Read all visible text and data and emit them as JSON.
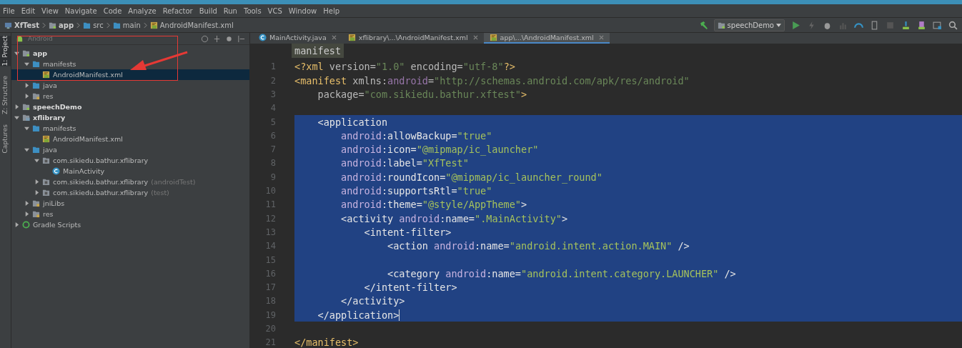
{
  "menu": [
    "File",
    "Edit",
    "View",
    "Navigate",
    "Code",
    "Analyze",
    "Refactor",
    "Build",
    "Run",
    "Tools",
    "VCS",
    "Window",
    "Help"
  ],
  "breadcrumbs": [
    {
      "label": "XfTest",
      "kind": "project"
    },
    {
      "label": "app",
      "kind": "module"
    },
    {
      "label": "src",
      "kind": "folder"
    },
    {
      "label": "main",
      "kind": "folder"
    },
    {
      "label": "AndroidManifest.xml",
      "kind": "manifest"
    }
  ],
  "run_config": "speechDemo",
  "tool_strip": [
    {
      "label": "1: Project",
      "selected": true
    },
    {
      "label": "Z: Structure",
      "selected": false
    },
    {
      "label": "Captures",
      "selected": false
    }
  ],
  "project_panel": {
    "view": "Android",
    "tree": [
      {
        "label": "app",
        "kind": "module",
        "bold": true,
        "expanded": true,
        "children": [
          {
            "label": "manifests",
            "kind": "folder",
            "expanded": true,
            "children": [
              {
                "label": "AndroidManifest.xml",
                "kind": "manifest",
                "selected": true
              }
            ]
          },
          {
            "label": "java",
            "kind": "folder",
            "expanded": false
          },
          {
            "label": "res",
            "kind": "res",
            "expanded": false
          }
        ]
      },
      {
        "label": "speechDemo",
        "kind": "module",
        "bold": true,
        "expanded": false
      },
      {
        "label": "xflibrary",
        "kind": "library",
        "bold": true,
        "expanded": true,
        "children": [
          {
            "label": "manifests",
            "kind": "folder",
            "expanded": true,
            "children": [
              {
                "label": "AndroidManifest.xml",
                "kind": "manifest",
                "selected": false
              }
            ]
          },
          {
            "label": "java",
            "kind": "folder",
            "expanded": true,
            "children": [
              {
                "label": "com.sikiedu.bathur.xflibrary",
                "kind": "package",
                "expanded": true,
                "children": [
                  {
                    "label": "MainActivity",
                    "kind": "class",
                    "selected": false
                  }
                ]
              },
              {
                "label": "com.sikiedu.bathur.xflibrary",
                "note": "(androidTest)",
                "kind": "package",
                "expanded": false
              },
              {
                "label": "com.sikiedu.bathur.xflibrary",
                "note": "(test)",
                "kind": "package",
                "expanded": false
              }
            ]
          },
          {
            "label": "jniLibs",
            "kind": "res",
            "expanded": false
          },
          {
            "label": "res",
            "kind": "res",
            "expanded": false
          }
        ]
      },
      {
        "label": "Gradle Scripts",
        "kind": "gradle",
        "bold": false,
        "expanded": false
      }
    ]
  },
  "editor_tabs": [
    {
      "label": "MainActivity.java",
      "kind": "class",
      "selected": false
    },
    {
      "label": "xflibrary\\...\\AndroidManifest.xml",
      "kind": "manifest",
      "selected": false
    },
    {
      "label": "app\\...\\AndroidManifest.xml",
      "kind": "manifest",
      "selected": true
    }
  ],
  "tag_breadcrumb": "manifest",
  "code_lines": [
    {
      "number": "1",
      "selected": false,
      "tokens": [
        {
          "kind": "tag",
          "text": "<?xml "
        },
        {
          "kind": "attr",
          "text": "version="
        },
        {
          "kind": "value",
          "text": "\"1.0\""
        },
        {
          "kind": "attr",
          "text": " encoding="
        },
        {
          "kind": "value",
          "text": "\"utf-8\""
        },
        {
          "kind": "tag",
          "text": "?>"
        }
      ]
    },
    {
      "number": "2",
      "selected": false,
      "tokens": [
        {
          "kind": "tag",
          "text": "<manifest "
        },
        {
          "kind": "attr",
          "text": "xmlns:"
        },
        {
          "kind": "ns",
          "text": "android"
        },
        {
          "kind": "attr",
          "text": "="
        },
        {
          "kind": "value",
          "text": "\"http://schemas.android.com/apk/res/android\""
        }
      ]
    },
    {
      "number": "3",
      "selected": false,
      "tokens": [
        {
          "kind": "attr",
          "text": "    package="
        },
        {
          "kind": "value",
          "text": "\"com.sikiedu.bathur.xftest\""
        },
        {
          "kind": "tag",
          "text": ">"
        }
      ]
    },
    {
      "number": "4",
      "selected": false
    },
    {
      "number": "5",
      "selected": true,
      "tokens": [
        {
          "kind": "tag",
          "text": "    <application"
        }
      ]
    },
    {
      "number": "6",
      "selected": true,
      "tokens": [
        {
          "kind": "ns",
          "text": "        android"
        },
        {
          "kind": "attr",
          "text": ":allowBackup="
        },
        {
          "kind": "value",
          "text": "\"true\""
        }
      ]
    },
    {
      "number": "7",
      "selected": true,
      "tokens": [
        {
          "kind": "ns",
          "text": "        android"
        },
        {
          "kind": "attr",
          "text": ":icon="
        },
        {
          "kind": "value",
          "text": "\"@mipmap/ic_launcher\""
        }
      ]
    },
    {
      "number": "8",
      "selected": true,
      "tokens": [
        {
          "kind": "ns",
          "text": "        android"
        },
        {
          "kind": "attr",
          "text": ":label="
        },
        {
          "kind": "value",
          "text": "\"XfTest\""
        }
      ]
    },
    {
      "number": "9",
      "selected": true,
      "tokens": [
        {
          "kind": "ns",
          "text": "        android"
        },
        {
          "kind": "attr",
          "text": ":roundIcon="
        },
        {
          "kind": "value",
          "text": "\"@mipmap/ic_launcher_round\""
        }
      ]
    },
    {
      "number": "10",
      "selected": true,
      "tokens": [
        {
          "kind": "ns",
          "text": "        android"
        },
        {
          "kind": "attr",
          "text": ":supportsRtl="
        },
        {
          "kind": "value",
          "text": "\"true\""
        }
      ]
    },
    {
      "number": "11",
      "selected": true,
      "tokens": [
        {
          "kind": "ns",
          "text": "        android"
        },
        {
          "kind": "attr",
          "text": ":theme="
        },
        {
          "kind": "value",
          "text": "\"@style/AppTheme\""
        },
        {
          "kind": "tag",
          "text": ">"
        }
      ]
    },
    {
      "number": "12",
      "selected": true,
      "tokens": [
        {
          "kind": "tag",
          "text": "        <activity "
        },
        {
          "kind": "ns",
          "text": "android"
        },
        {
          "kind": "attr",
          "text": ":name="
        },
        {
          "kind": "value",
          "text": "\".MainActivity\""
        },
        {
          "kind": "tag",
          "text": ">"
        }
      ]
    },
    {
      "number": "13",
      "selected": true,
      "tokens": [
        {
          "kind": "tag",
          "text": "            <intent-filter>"
        }
      ]
    },
    {
      "number": "14",
      "selected": true,
      "tokens": [
        {
          "kind": "tag",
          "text": "                <action "
        },
        {
          "kind": "ns",
          "text": "android"
        },
        {
          "kind": "attr",
          "text": ":name="
        },
        {
          "kind": "value",
          "text": "\"android.intent.action.MAIN\""
        },
        {
          "kind": "tag",
          "text": " />"
        }
      ]
    },
    {
      "number": "15",
      "selected": true
    },
    {
      "number": "16",
      "selected": true,
      "tokens": [
        {
          "kind": "tag",
          "text": "                <category "
        },
        {
          "kind": "ns",
          "text": "android"
        },
        {
          "kind": "attr",
          "text": ":name="
        },
        {
          "kind": "value",
          "text": "\"android.intent.category.LAUNCHER\""
        },
        {
          "kind": "tag",
          "text": " />"
        }
      ]
    },
    {
      "number": "17",
      "selected": true,
      "tokens": [
        {
          "kind": "tag",
          "text": "            </intent-filter>"
        }
      ]
    },
    {
      "number": "18",
      "selected": true,
      "tokens": [
        {
          "kind": "tag",
          "text": "        </activity>"
        }
      ]
    },
    {
      "number": "19",
      "selected": true,
      "tokens": [
        {
          "kind": "tag",
          "text": "    </application>"
        }
      ]
    },
    {
      "number": "20",
      "selected": false
    },
    {
      "number": "21",
      "selected": false,
      "tokens": [
        {
          "kind": "tag",
          "text": "</manifest>"
        }
      ]
    }
  ]
}
